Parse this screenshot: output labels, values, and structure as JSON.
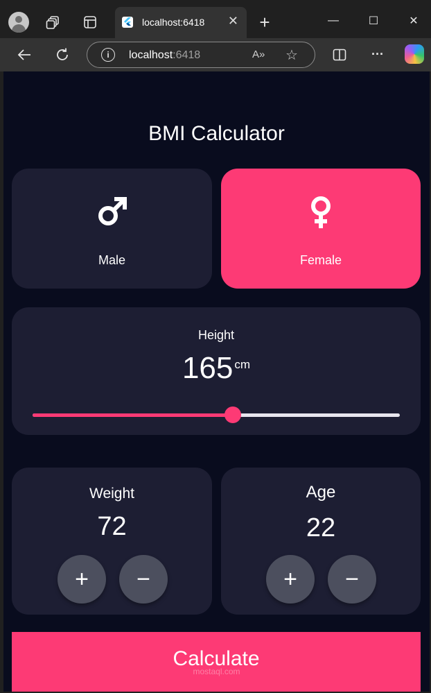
{
  "browser": {
    "tab_title": "localhost:6418",
    "tab_close": "✕",
    "new_tab": "+",
    "url_host": "localhost",
    "url_port": ":6418",
    "read_aloud": "A»",
    "favorite": "☆",
    "window": {
      "minimize": "—",
      "maximize": "☐",
      "close": "✕"
    },
    "more": "···"
  },
  "app": {
    "title": "BMI Calculator",
    "gender": {
      "male": {
        "label": "Male",
        "symbol": "♂",
        "selected": false
      },
      "female": {
        "label": "Female",
        "symbol": "♀",
        "selected": true
      }
    },
    "height": {
      "label": "Height",
      "value": "165",
      "unit": "cm",
      "slider_fraction": 0.545
    },
    "weight": {
      "label": "Weight",
      "value": "72",
      "plus": "+",
      "minus": "−"
    },
    "age": {
      "label": "Age",
      "value": "22",
      "plus": "+",
      "minus": "−"
    },
    "calculate_label": "Calculate",
    "watermark": "mostaql.com"
  },
  "colors": {
    "background": "#090c1e",
    "card": "#1d1e33",
    "accent": "#fd3a75",
    "button": "#4c4f5e"
  }
}
